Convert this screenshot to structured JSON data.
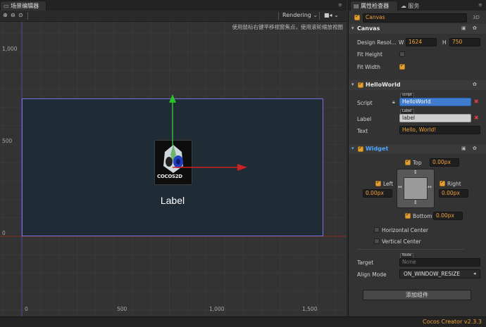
{
  "scene": {
    "tab_label": "场景编辑器",
    "menu_glyph": "≡",
    "render_mode": "Rendering",
    "hint": "使用鼠标右键平移视窗焦点，使用滚轮缩放视图",
    "rulers": {
      "y_top": "1,000",
      "y_mid": "500",
      "y_zero": "0",
      "x_zero": "0",
      "x_500": "500",
      "x_1000": "1,000",
      "x_1500": "1,500"
    },
    "node_label": "Label",
    "logo_text": "COCOS2D"
  },
  "inspector": {
    "tab_props": "属性检查器",
    "tab_service": "服务",
    "node_name": "Canvas",
    "mode_3d": "3D",
    "canvas": {
      "title": "Canvas",
      "design_resolution_label": "Design Resol...",
      "w_label": "W",
      "w_value": "1624",
      "h_label": "H",
      "h_value": "750",
      "fit_height_label": "Fit Height",
      "fit_height": false,
      "fit_width_label": "Fit Width",
      "fit_width": true
    },
    "helloworld": {
      "title": "HelloWorld",
      "script_label": "Script",
      "script_tag": "script",
      "script_value": "HelloWorld",
      "label_label": "Label",
      "label_tag": "Label",
      "label_value": "label",
      "text_label": "Text",
      "text_value": "Hello, World!"
    },
    "widget": {
      "title": "Widget",
      "top_label": "Top",
      "top_value": "0.00px",
      "left_label": "Left",
      "left_value": "0.00px",
      "right_label": "Right",
      "right_value": "0.00px",
      "bottom_label": "Bottom",
      "bottom_value": "0.00px",
      "horizontal_center": "Horizontal Center",
      "vertical_center": "Vertical Center",
      "target_tag": "Node",
      "target_label": "Target",
      "target_value": "None",
      "align_mode_label": "Align Mode",
      "align_mode_value": "ON_WINDOW_RESIZE"
    },
    "add_component": "添加组件"
  },
  "status": {
    "version": "Cocos Creator v2.3.3"
  },
  "colors": {
    "accent": "#e3a030",
    "selection_blue": "#3f7ccf",
    "canvas_border": "#7e6fe0",
    "widget_blue": "#4ea7ff",
    "version_text": "#f0a030"
  }
}
